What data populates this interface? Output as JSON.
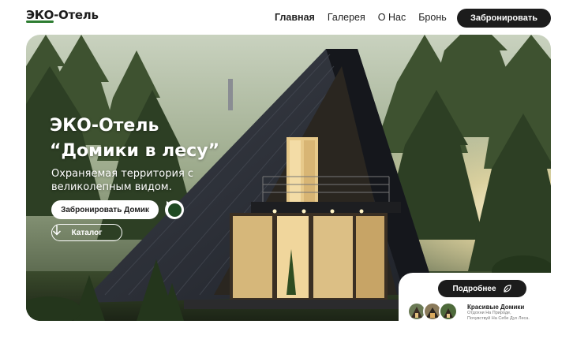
{
  "header": {
    "logo_part1": "ЭКО",
    "logo_part2": "-Отель",
    "nav": [
      "Главная",
      "Галерея",
      "О Нас",
      "Бронь"
    ],
    "cta_label": "Забронировать"
  },
  "hero": {
    "title": "ЭКО-Отель",
    "subtitle": "“Домики в лесу”",
    "description": "Охраняемая территория с великолепным видом.",
    "book_button": "Забронировать Домик",
    "catalog_button": "Каталог"
  },
  "card": {
    "more_button": "Подробнее",
    "title": "Красивые Домики",
    "text": "Отдохни На Природе, Почувствуй На Себе Дух Леса."
  },
  "colors": {
    "accent": "#1c1c1c",
    "brand_green": "#2e7d32"
  },
  "icons": [
    "play-icon",
    "arrow-down-icon",
    "leaf-icon"
  ]
}
